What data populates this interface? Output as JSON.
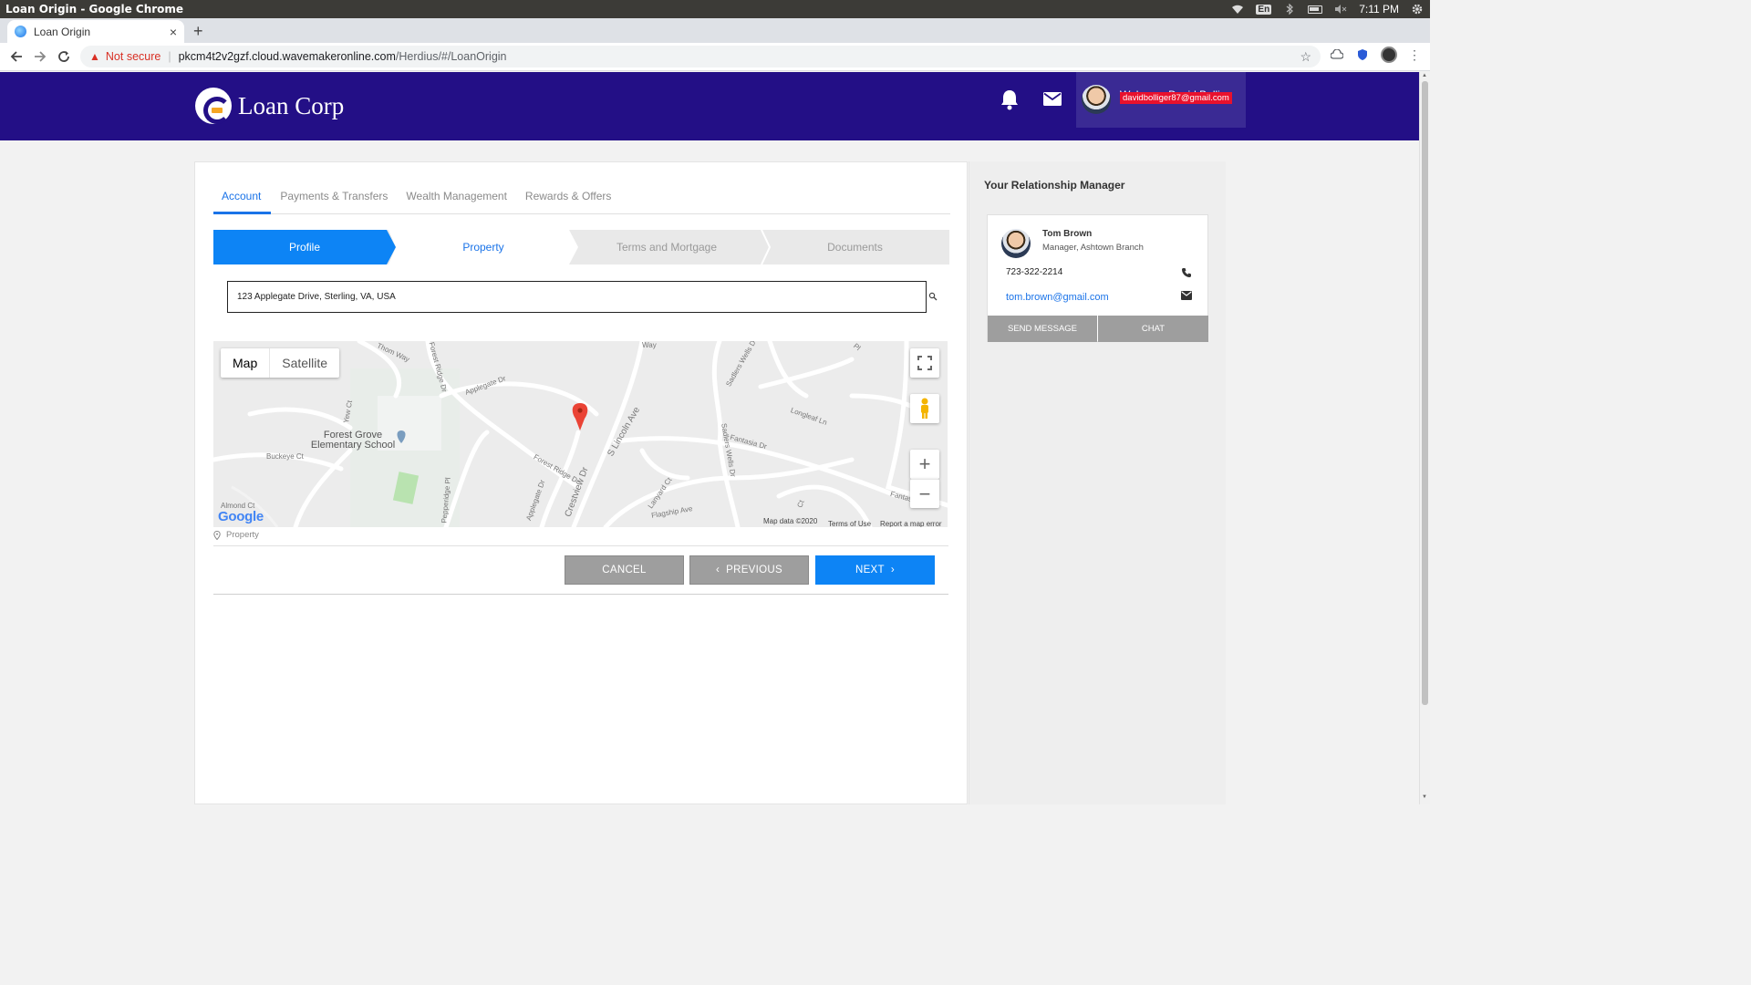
{
  "os": {
    "window_title": "Loan Origin - Google Chrome",
    "lang": "En",
    "time": "7:11 PM"
  },
  "browser": {
    "tab_title": "Loan Origin",
    "tab_close": "×",
    "new_tab": "+",
    "not_secure": "Not secure",
    "url_host": "pkcm4t2v2gzf.cloud.wavemakeronline.com",
    "url_path": "/Herdius/#/LoanOrigin"
  },
  "header": {
    "brand": "Loan Corp",
    "welcome": "Welcome David Bollig",
    "user_email": "davidbolliger87@gmail.com",
    "header_color": "#230f86"
  },
  "nav_tabs": [
    {
      "label": "Account",
      "active": true
    },
    {
      "label": "Payments & Transfers",
      "active": false
    },
    {
      "label": "Wealth Management",
      "active": false
    },
    {
      "label": "Rewards & Offers",
      "active": false
    }
  ],
  "wizard": {
    "steps": [
      "Profile",
      "Property",
      "Terms and Mortgage",
      "Documents"
    ],
    "active_step": "Profile",
    "current_step": "Property"
  },
  "address": {
    "value": "123 Applegate Drive, Sterling, VA, USA"
  },
  "map": {
    "type_map": "Map",
    "type_satellite": "Satellite",
    "zoom_in": "+",
    "zoom_out": "−",
    "labels": {
      "thom_way": "Thom Way",
      "forest_ridge_dr_top": "Forest Ridge Dr",
      "applegate_dr": "Applegate Dr",
      "sadlers_wells_dr_top": "Sadlers Wells D",
      "longleaf_ln": "Longleaf Ln",
      "fantasia_dr": "Fantasia Dr",
      "sadlers_wells_dr": "Sadlers Wells Dr",
      "s_lincoln_ave": "S Lincoln Ave",
      "crestview_dr": "Crestview Dr",
      "forest_ridge_dr": "Forest Ridge Dr",
      "buckeye_ct": "Buckeye Ct",
      "almond_ct": "Almond Ct",
      "pepperidge_pl": "Pepperidge Pl",
      "applegate_dr_lower": "Applegate Dr",
      "flagship_ave": "Flagship Ave",
      "lanyard_ct": "Lanyard Ct",
      "yew_ct": "Yew Ct",
      "way_top": "Way",
      "pl_top": "Pl",
      "fantasia_right": "Fantas",
      "ct_low": "Ct"
    },
    "poi": "Forest Grove Elementary School",
    "google": "Google",
    "map_data": "Map data ©2020",
    "terms": "Terms of Use",
    "report": "Report a map error",
    "caption": "Property"
  },
  "actions": {
    "cancel": "CANCEL",
    "previous": "PREVIOUS",
    "next": "NEXT",
    "prev_chevron": "‹",
    "next_chevron": "›"
  },
  "relationship_manager": {
    "title": "Your Relationship Manager",
    "name": "Tom Brown",
    "role": "Manager, Ashtown Branch",
    "phone": "723-322-2214",
    "email": "tom.brown@gmail.com",
    "send_message": "SEND MESSAGE",
    "chat": "CHAT"
  },
  "colors": {
    "accent": "#0d84f5",
    "header": "#230f86",
    "button_gray": "#9e9e9e",
    "email_badge": "#e8112d",
    "logo_accent": "#f5a623"
  }
}
